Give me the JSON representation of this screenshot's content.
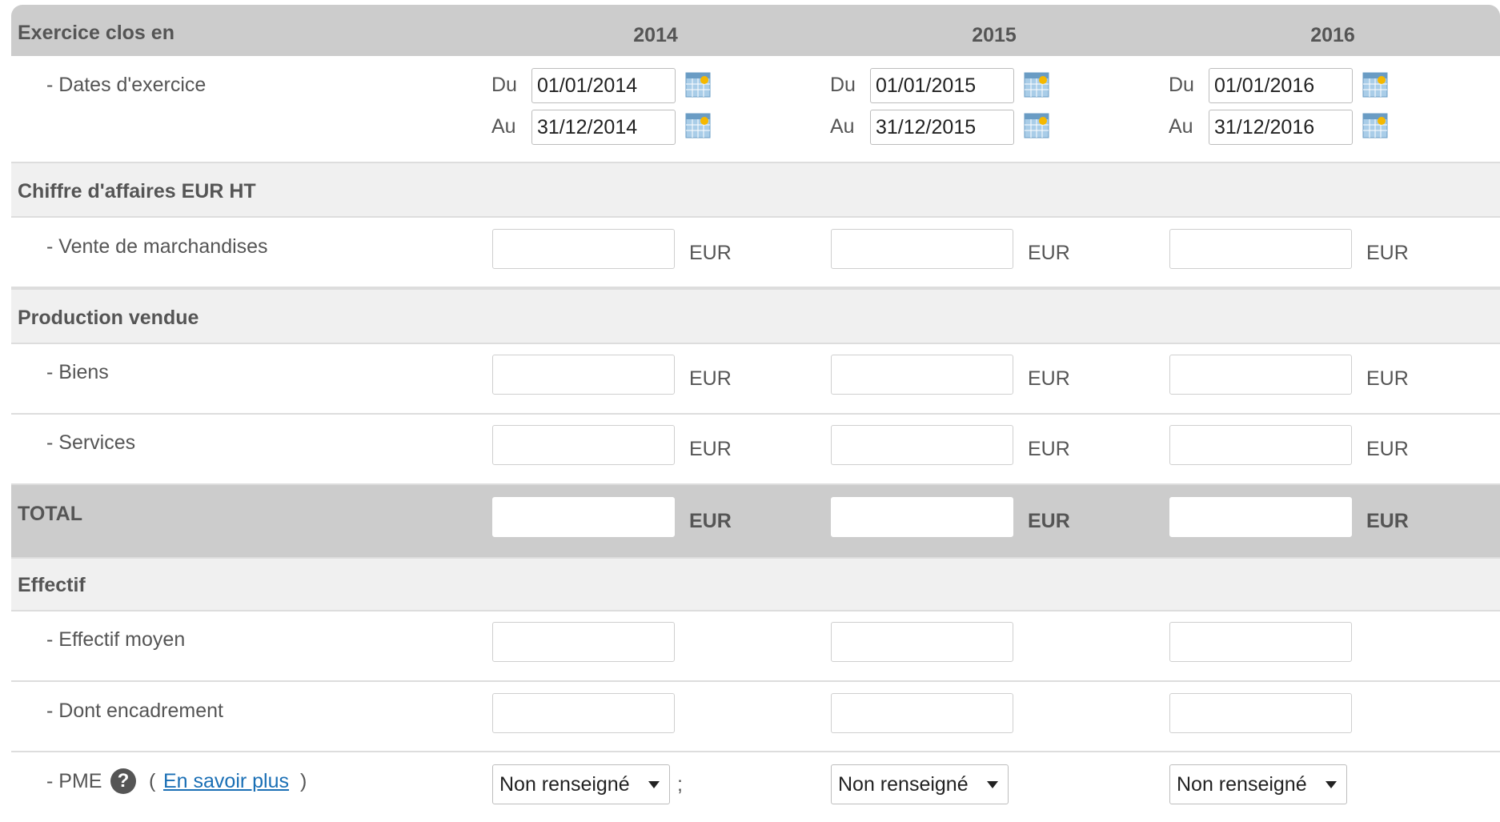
{
  "header": {
    "label": "Exercice clos en",
    "years": [
      "2014",
      "2015",
      "2016"
    ]
  },
  "dates": {
    "label": "- Dates d'exercice",
    "du_label": "Du",
    "au_label": "Au",
    "du_values": [
      "01/01/2014",
      "01/01/2015",
      "01/01/2016"
    ],
    "au_values": [
      "31/12/2014",
      "31/12/2015",
      "31/12/2016"
    ]
  },
  "sections": {
    "chiffre": "Chiffre d'affaires EUR HT",
    "production": "Production vendue",
    "total": "TOTAL",
    "effectif": "Effectif"
  },
  "rows": {
    "vente": "- Vente de marchandises",
    "biens": "- Biens",
    "services": "- Services",
    "effectif_moyen": "- Effectif moyen",
    "encadrement": "- Dont encadrement",
    "pme": "- PME"
  },
  "unit": "EUR",
  "pme": {
    "help_glyph": "?",
    "open_paren": "(",
    "link": "En savoir plus",
    "close_paren": ")",
    "separator": ";",
    "select_values": [
      "Non renseigné",
      "Non renseigné",
      "Non renseigné"
    ]
  },
  "icons": {
    "calendar": "calendar-icon",
    "help": "help-icon",
    "dropdown": "chevron-down-icon"
  },
  "colors": {
    "header_bg": "#cccccc",
    "section_bg": "#f0f0f0",
    "link": "#1a6fb5"
  }
}
